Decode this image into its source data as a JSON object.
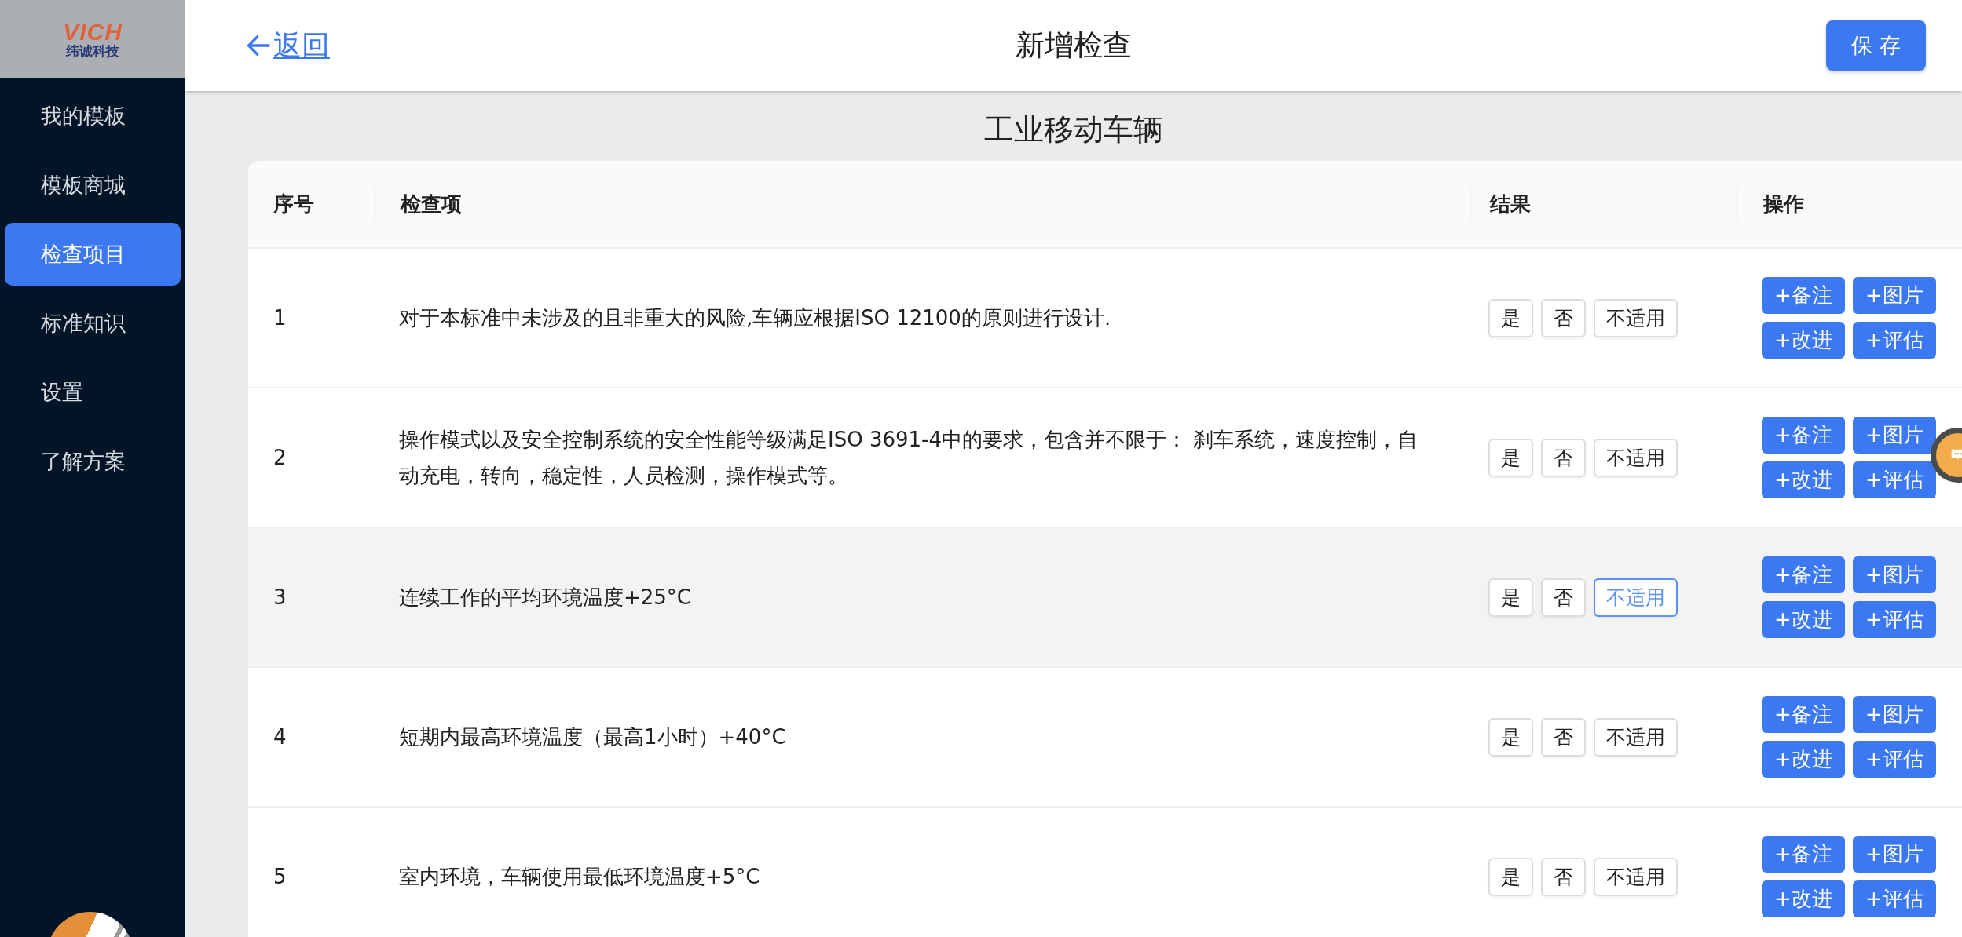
{
  "logo": {
    "mark": "VICH",
    "name": "纬诚科技"
  },
  "sidebar": {
    "items": [
      {
        "label": "我的模板",
        "selected": false
      },
      {
        "label": "模板商城",
        "selected": false
      },
      {
        "label": "检查项目",
        "selected": true
      },
      {
        "label": "标准知识",
        "selected": false
      },
      {
        "label": "设置",
        "selected": false
      },
      {
        "label": "了解方案",
        "selected": false
      }
    ]
  },
  "header": {
    "back": "返回",
    "title": "新增检查",
    "save": "保 存"
  },
  "subtitle": "工业移动车辆",
  "table": {
    "columns": [
      "序号",
      "检查项",
      "结果",
      "操作"
    ],
    "rows": [
      {
        "index": "1",
        "item": "对于本标准中未涉及的且非重大的风险,车辆应根据ISO 12100的原则进行设计.",
        "highlighted": false,
        "results": [
          {
            "label": "是",
            "selected": false
          },
          {
            "label": "否",
            "selected": false
          },
          {
            "label": "不适用",
            "selected": false
          }
        ],
        "actions": [
          "+备注",
          "+图片",
          "+改进",
          "+评估"
        ]
      },
      {
        "index": "2",
        "item": "操作模式以及安全控制系统的安全性能等级满足ISO 3691-4中的要求，包含并不限于： 刹车系统，速度控制，自动充电，转向，稳定性，人员检测，操作模式等。",
        "highlighted": false,
        "results": [
          {
            "label": "是",
            "selected": false
          },
          {
            "label": "否",
            "selected": false
          },
          {
            "label": "不适用",
            "selected": false
          }
        ],
        "actions": [
          "+备注",
          "+图片",
          "+改进",
          "+评估"
        ]
      },
      {
        "index": "3",
        "item": "连续工作的平均环境温度+25°C",
        "highlighted": true,
        "results": [
          {
            "label": "是",
            "selected": false
          },
          {
            "label": "否",
            "selected": false
          },
          {
            "label": "不适用",
            "selected": true
          }
        ],
        "actions": [
          "+备注",
          "+图片",
          "+改进",
          "+评估"
        ]
      },
      {
        "index": "4",
        "item": "短期内最高环境温度（最高1小时）+40°C",
        "highlighted": false,
        "results": [
          {
            "label": "是",
            "selected": false
          },
          {
            "label": "否",
            "selected": false
          },
          {
            "label": "不适用",
            "selected": false
          }
        ],
        "actions": [
          "+备注",
          "+图片",
          "+改进",
          "+评估"
        ]
      },
      {
        "index": "5",
        "item": "室内环境，车辆使用最低环境温度+5°C",
        "highlighted": false,
        "results": [
          {
            "label": "是",
            "selected": false
          },
          {
            "label": "否",
            "selected": false
          },
          {
            "label": "不适用",
            "selected": false
          }
        ],
        "actions": [
          "+备注",
          "+图片",
          "+改进",
          "+评估"
        ]
      }
    ]
  }
}
